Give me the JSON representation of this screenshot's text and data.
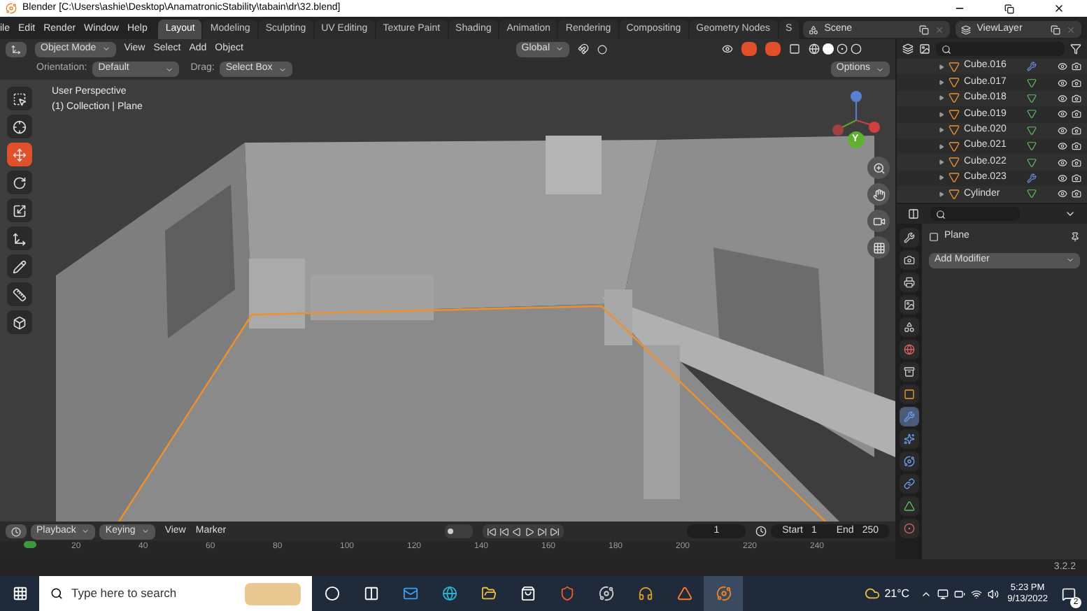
{
  "window": {
    "title": "Blender [C:\\Users\\ashie\\Desktop\\AnamatronicStability\\tabain\\dr\\32.blend]"
  },
  "menu": [
    "ile",
    "Edit",
    "Render",
    "Window",
    "Help"
  ],
  "workspaces": [
    {
      "label": "Layout",
      "selected": true
    },
    {
      "label": "Modeling",
      "selected": false
    },
    {
      "label": "Sculpting",
      "selected": false
    },
    {
      "label": "UV Editing",
      "selected": false
    },
    {
      "label": "Texture Paint",
      "selected": false
    },
    {
      "label": "Shading",
      "selected": false
    },
    {
      "label": "Animation",
      "selected": false
    },
    {
      "label": "Rendering",
      "selected": false
    },
    {
      "label": "Compositing",
      "selected": false
    },
    {
      "label": "Geometry Nodes",
      "selected": false
    },
    {
      "label": "S",
      "selected": false
    }
  ],
  "scene": "Scene",
  "view_layer": "ViewLayer",
  "viewport": {
    "mode": "Object Mode",
    "menus": [
      "View",
      "Select",
      "Add",
      "Object"
    ],
    "transform_orientation": "Global",
    "tool_settings": {
      "orientation_label": "Orientation:",
      "orientation": "Default",
      "drag_label": "Drag:",
      "drag": "Select Box",
      "options": "Options"
    },
    "overlay_lines": [
      "User Perspective",
      "(1) Collection | Plane"
    ],
    "gizmo_label": "Y",
    "tools": [
      {
        "kind": "select",
        "selected": false
      },
      {
        "kind": "cursor",
        "selected": false
      },
      {
        "kind": "move",
        "selected": true
      },
      {
        "kind": "rotate",
        "selected": false
      },
      {
        "kind": "scale",
        "selected": false
      },
      {
        "kind": "transform",
        "selected": false
      },
      {
        "kind": "annotate",
        "selected": false
      },
      {
        "kind": "measure",
        "selected": false
      },
      {
        "kind": "add_cube",
        "selected": false
      }
    ]
  },
  "outliner": {
    "items": [
      {
        "name": "Cube.016",
        "kind": "modifier"
      },
      {
        "name": "Cube.017",
        "kind": "mesh"
      },
      {
        "name": "Cube.018",
        "kind": "mesh"
      },
      {
        "name": "Cube.019",
        "kind": "mesh"
      },
      {
        "name": "Cube.020",
        "kind": "mesh"
      },
      {
        "name": "Cube.021",
        "kind": "mesh"
      },
      {
        "name": "Cube.022",
        "kind": "mesh"
      },
      {
        "name": "Cube.023",
        "kind": "modifier"
      },
      {
        "name": "Cylinder",
        "kind": "mesh"
      }
    ]
  },
  "properties": {
    "object": "Plane",
    "add_modifier": "Add Modifier",
    "tabs": [
      {
        "kind": "tool",
        "selected": false
      },
      {
        "kind": "render",
        "selected": false
      },
      {
        "kind": "output",
        "selected": false
      },
      {
        "kind": "view_layer",
        "selected": false
      },
      {
        "kind": "scene",
        "selected": false
      },
      {
        "kind": "world",
        "selected": false
      },
      {
        "kind": "collection",
        "selected": false
      },
      {
        "kind": "object",
        "selected": false
      },
      {
        "kind": "modifier",
        "selected": true
      },
      {
        "kind": "particles",
        "selected": false
      },
      {
        "kind": "physics",
        "selected": false
      },
      {
        "kind": "constraints",
        "selected": false
      },
      {
        "kind": "data",
        "selected": false
      },
      {
        "kind": "material",
        "selected": false
      }
    ]
  },
  "timeline": {
    "menus": [
      "Playback",
      "Keying",
      "View",
      "Marker"
    ],
    "current_frame": "1",
    "start_label": "Start",
    "start": "1",
    "end_label": "End",
    "end": "250",
    "ruler": [
      "20",
      "40",
      "60",
      "80",
      "100",
      "120",
      "140",
      "160",
      "180",
      "200",
      "220",
      "240"
    ]
  },
  "status_bar": {
    "version": "3.2.2"
  },
  "taskbar": {
    "search_placeholder": "Type here to search",
    "weather": "21°C",
    "time": "5:23 PM",
    "date": "9/13/2022",
    "notifications": "2",
    "apps": [
      {
        "kind": "cortana",
        "selected": false
      },
      {
        "kind": "task_view",
        "selected": false
      },
      {
        "kind": "mail",
        "selected": false
      },
      {
        "kind": "edge",
        "selected": false
      },
      {
        "kind": "explorer",
        "selected": false
      },
      {
        "kind": "store",
        "selected": false
      },
      {
        "kind": "brave",
        "selected": false
      },
      {
        "kind": "planet",
        "selected": false
      },
      {
        "kind": "headphones",
        "selected": false
      },
      {
        "kind": "orange_app",
        "selected": false
      },
      {
        "kind": "blender",
        "selected": true
      }
    ]
  }
}
